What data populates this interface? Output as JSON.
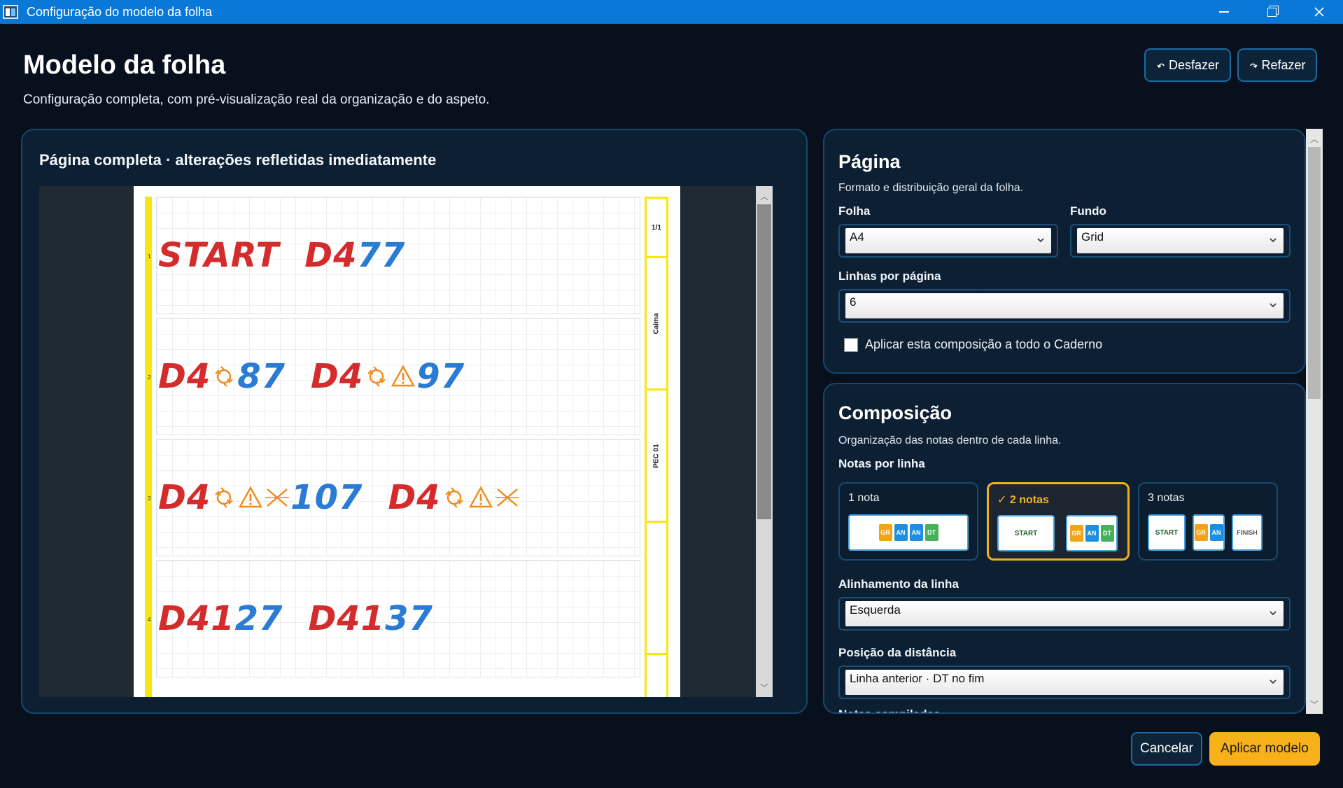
{
  "window": {
    "title": "Configuração do modelo da folha"
  },
  "header": {
    "title": "Modelo da folha",
    "subtitle": "Configuração completa, com pré-visualização real da organização e do aspeto.",
    "undo_label": "Desfazer",
    "redo_label": "Refazer"
  },
  "preview": {
    "title": "Página completa · alterações refletidas imediatamente",
    "rows": [
      {
        "num": "1",
        "tokens": [
          {
            "t": "START",
            "c": "red"
          },
          {
            "gap": true
          },
          {
            "t": "D4",
            "c": "red"
          },
          {
            "t": "77",
            "c": "blue"
          }
        ]
      },
      {
        "num": "2",
        "tokens": [
          {
            "t": "D4",
            "c": "red"
          },
          {
            "s": "rotate"
          },
          {
            "t": "87",
            "c": "blue"
          },
          {
            "gap": true
          },
          {
            "t": "D4",
            "c": "red"
          },
          {
            "s": "rotate"
          },
          {
            "s": "warning"
          },
          {
            "t": "97",
            "c": "blue"
          }
        ]
      },
      {
        "num": "3",
        "tokens": [
          {
            "t": "D4",
            "c": "red"
          },
          {
            "s": "rotate"
          },
          {
            "s": "warning"
          },
          {
            "s": "cross"
          },
          {
            "t": "107",
            "c": "blue"
          },
          {
            "gap": true
          },
          {
            "t": "D4",
            "c": "red"
          },
          {
            "s": "rotate"
          },
          {
            "s": "warning"
          },
          {
            "s": "cross"
          }
        ]
      },
      {
        "num": "4",
        "tokens": [
          {
            "t": "D41",
            "c": "red"
          },
          {
            "t": "27",
            "c": "blue"
          },
          {
            "gap": true
          },
          {
            "t": "D41",
            "c": "red"
          },
          {
            "t": "37",
            "c": "blue"
          }
        ]
      }
    ],
    "side": {
      "page": "1/1",
      "caima": "Caima",
      "pec": "PEC 01"
    }
  },
  "pagina": {
    "title": "Página",
    "desc": "Formato e distribuição geral da folha.",
    "folha_label": "Folha",
    "folha_value": "A4",
    "fundo_label": "Fundo",
    "fundo_value": "Grid",
    "linhas_label": "Linhas por página",
    "linhas_value": "6",
    "apply_all_label": "Aplicar esta composição a todo o Caderno"
  },
  "composicao": {
    "title": "Composição",
    "desc": "Organização das notas dentro de cada linha.",
    "notas_label": "Notas por linha",
    "options": [
      {
        "label": "1 nota"
      },
      {
        "label": "✓ 2 notas"
      },
      {
        "label": "3 notas"
      }
    ],
    "chips": {
      "gr": "GR",
      "an": "AN",
      "dt": "DT",
      "start": "START",
      "finish": "FINISH"
    },
    "alinhamento_label": "Alinhamento da linha",
    "alinhamento_value": "Esquerda",
    "distancia_label": "Posição da distância",
    "distancia_value": "Linha anterior · DT no fim",
    "next_label": "Notas compiladas"
  },
  "footer": {
    "cancel_label": "Cancelar",
    "apply_label": "Aplicar modelo"
  },
  "colors": {
    "accent": "#0a78d6",
    "yellow": "#f6e711",
    "apply": "#f7b21b",
    "red": "#d42c2c",
    "blue": "#2a7bd4",
    "orange": "#f08a1c"
  }
}
